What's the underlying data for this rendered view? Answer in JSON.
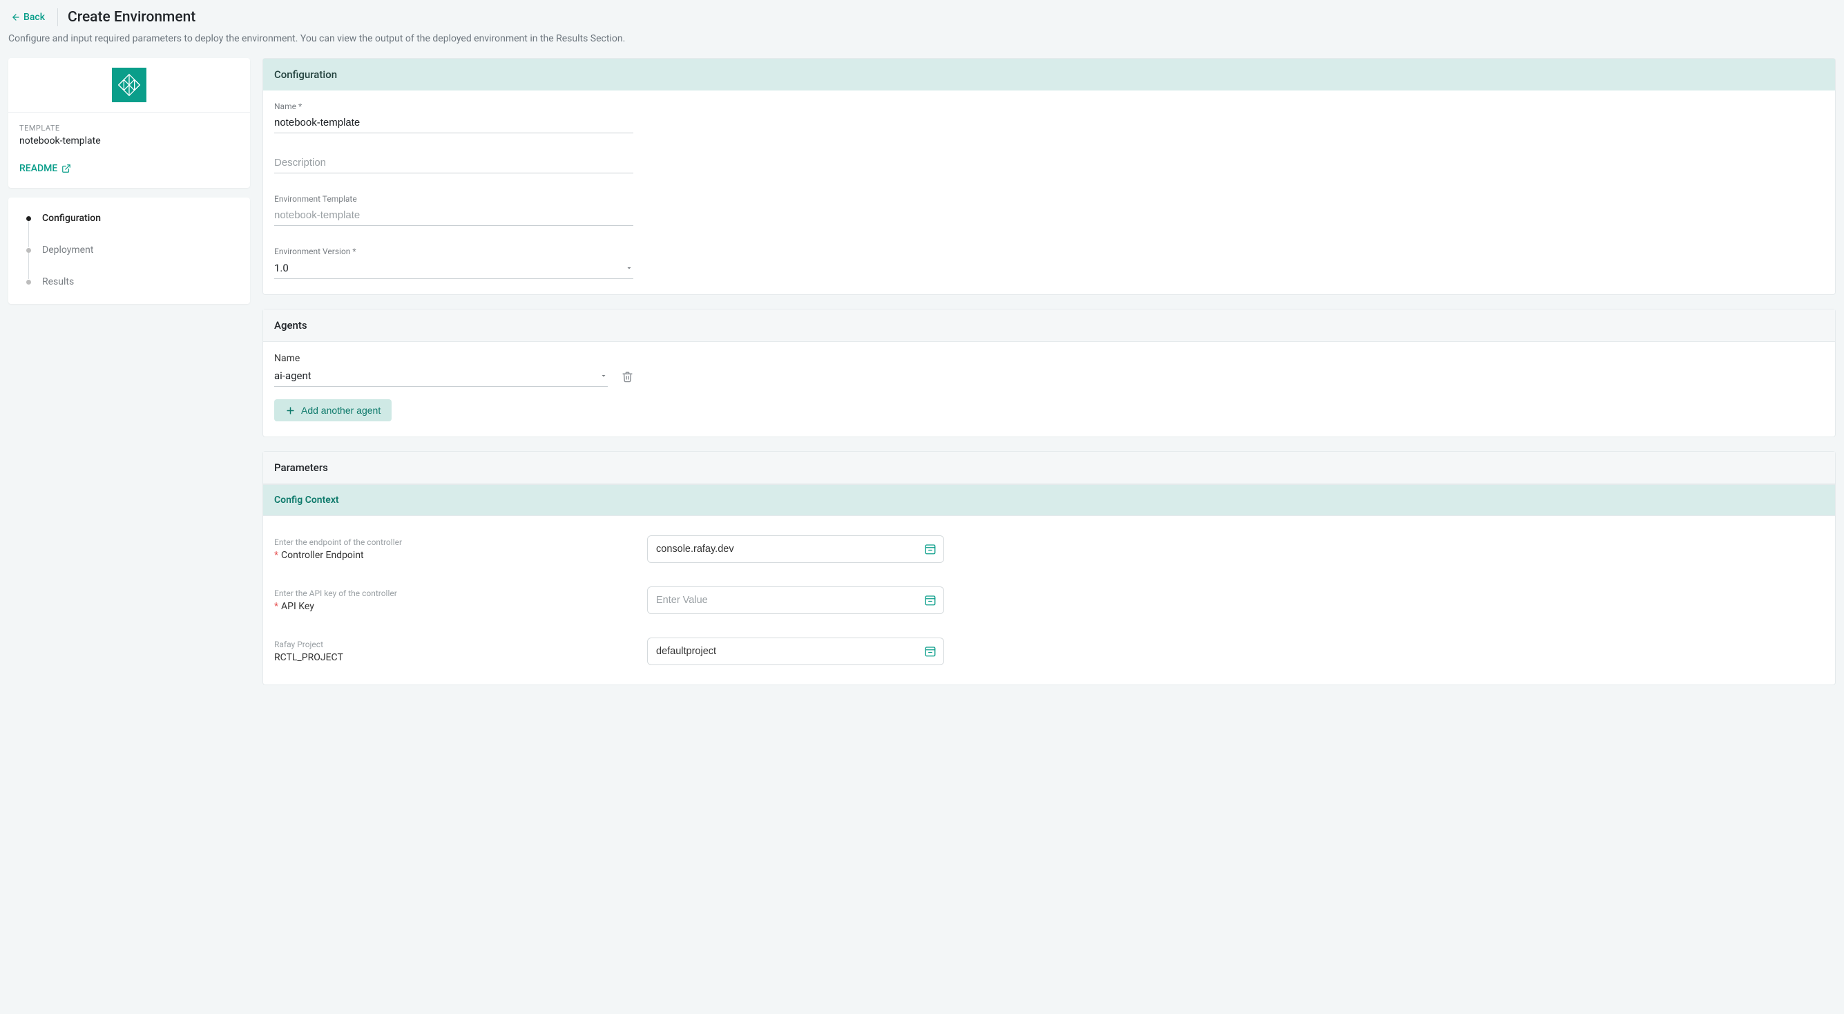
{
  "header": {
    "back_label": "Back",
    "title": "Create Environment",
    "subtitle": "Configure and input required parameters to deploy the environment. You can view the output of the deployed environment in the Results Section."
  },
  "sidebar": {
    "template_label": "TEMPLATE",
    "template_name": "notebook-template",
    "readme_label": "README",
    "steps": [
      {
        "label": "Configuration",
        "active": true
      },
      {
        "label": "Deployment",
        "active": false
      },
      {
        "label": "Results",
        "active": false
      }
    ]
  },
  "configuration": {
    "section_title": "Configuration",
    "name_label": "Name *",
    "name_value": "notebook-template",
    "description_placeholder": "Description",
    "description_value": "",
    "env_template_label": "Environment Template",
    "env_template_value": "notebook-template",
    "env_version_label": "Environment Version *",
    "env_version_value": "1.0"
  },
  "agents": {
    "section_title": "Agents",
    "name_label": "Name",
    "selected_agent": "ai-agent",
    "add_button_label": "Add another agent"
  },
  "parameters": {
    "section_title": "Parameters",
    "config_context_title": "Config Context",
    "rows": [
      {
        "help": "Enter the endpoint of the controller",
        "required": true,
        "label": "Controller Endpoint",
        "value": "console.rafay.dev",
        "placeholder": ""
      },
      {
        "help": "Enter the API key of the controller",
        "required": true,
        "label": "API Key",
        "value": "",
        "placeholder": "Enter Value"
      },
      {
        "help": "Rafay Project",
        "required": false,
        "label": "RCTL_PROJECT",
        "value": "defaultproject",
        "placeholder": ""
      }
    ]
  }
}
